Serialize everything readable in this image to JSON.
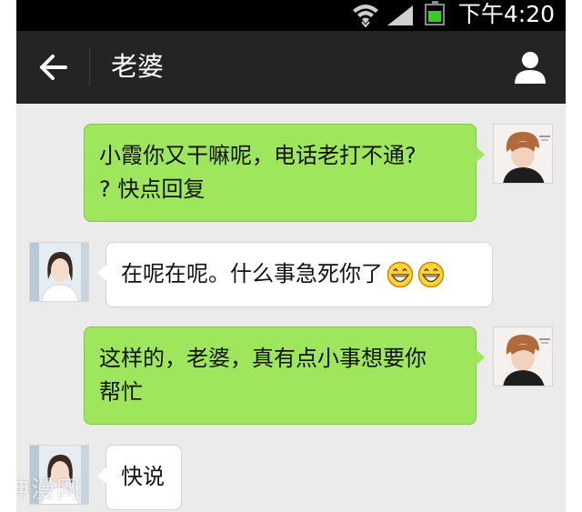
{
  "status_bar": {
    "time": "下午4:20",
    "battery_color": "#35d01f"
  },
  "header": {
    "title": "老婆",
    "back_icon": "arrow-left-icon",
    "profile_icon": "person-icon"
  },
  "colors": {
    "outgoing_bubble": "#9ee75c",
    "incoming_bubble": "#ffffff",
    "chat_background": "#ebebeb",
    "title_bar": "#242424"
  },
  "messages": [
    {
      "direction": "outgoing",
      "text_line1": "小霞你又干嘛呢，电话老打不通?",
      "text_line2": "? 快点回复"
    },
    {
      "direction": "incoming",
      "text": "在呢在呢。什么事急死你了",
      "emojis": [
        "grin-emoji",
        "grin-emoji"
      ]
    },
    {
      "direction": "outgoing",
      "text_line1": "这样的，老婆，真有点小事想要你",
      "text_line2": "帮忙"
    },
    {
      "direction": "incoming",
      "text": "快说"
    }
  ],
  "watermark": "神漫网"
}
